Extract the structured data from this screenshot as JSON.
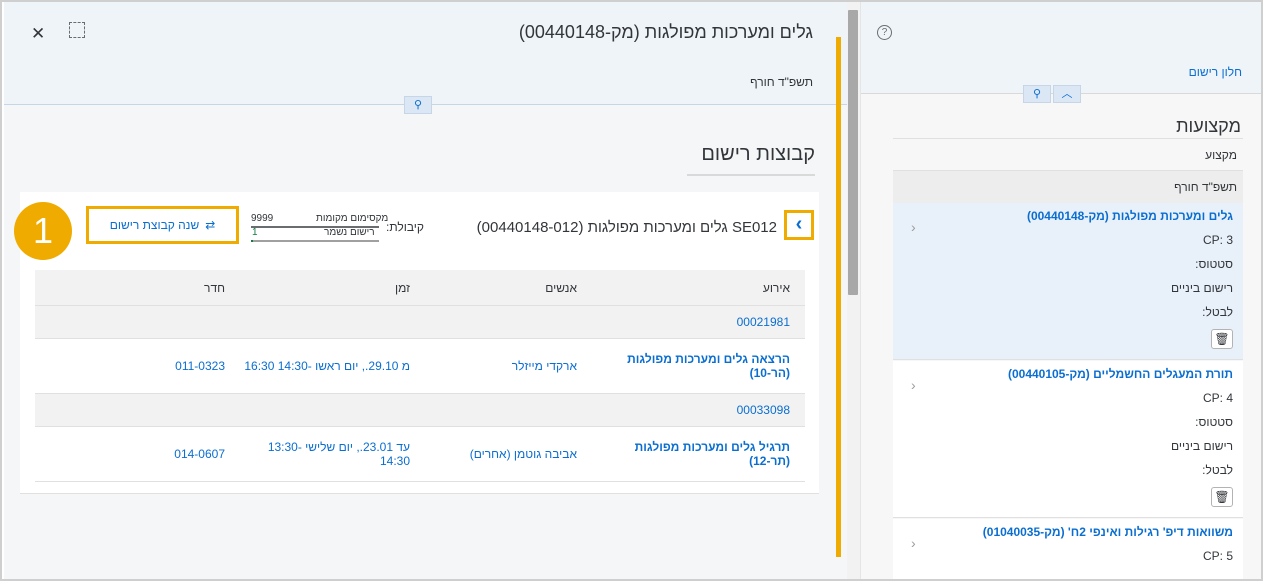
{
  "main": {
    "title": "גלים ומערכות מפולגות (מק-00440148)",
    "subtitle": "תשפ\"ד חורף",
    "section_title": "קבוצות רישום",
    "group": {
      "title": "SE012 גלים ומערכות מפולגות (00440148-012)",
      "capacity_label": "קיבולת:",
      "max_label": "מקסימום מקומות",
      "max_value": "9999",
      "saved_label": "רישום נשמר",
      "saved_value": "1",
      "saved_fraction": 0.0001
    },
    "change_button": "שנה קבוצת רישום",
    "callout_number": "1",
    "table": {
      "headers": [
        "אירוע",
        "אנשים",
        "זמן",
        "חדר"
      ],
      "groups": [
        {
          "id": "00021981",
          "event": "הרצאה גלים ומערכות מפולגות (הר-10)",
          "people": "ארקדי מייזלר",
          "time": "מ 29.10., יום ראשו -14:30 16:30",
          "room": "011-0323"
        },
        {
          "id": "00033098",
          "event": "תרגיל גלים ומערכות מפולגות (תר-12)",
          "people": "אביבה גוטמן (אחרים)",
          "time": "עד 23.01., יום שלישי -13:30 14:30",
          "room": "014-0607"
        }
      ]
    }
  },
  "right": {
    "link": "חלון רישום",
    "title": "מקצועות",
    "row1": "מקצוע",
    "row2": "תשפ\"ד חורף",
    "cards": [
      {
        "title": "גלים ומערכות מפולגות (מק-00440148)",
        "cp": "CP: 3",
        "status_label": "סטטוס:",
        "status": "רישום ביניים",
        "cancel": "לבטל:"
      },
      {
        "title": "תורת המעגלים החשמליים (מק-00440105)",
        "cp": "CP: 4",
        "status_label": "סטטוס:",
        "status": "רישום ביניים",
        "cancel": "לבטל:"
      },
      {
        "title": "משוואות דיפ' רגילות ואינפי 2ח' (מק-01040035)",
        "cp": "CP: 5"
      }
    ]
  },
  "colors": {
    "accent": "#0a6ed1",
    "highlight": "#f0ab00",
    "success": "#107e3e"
  }
}
